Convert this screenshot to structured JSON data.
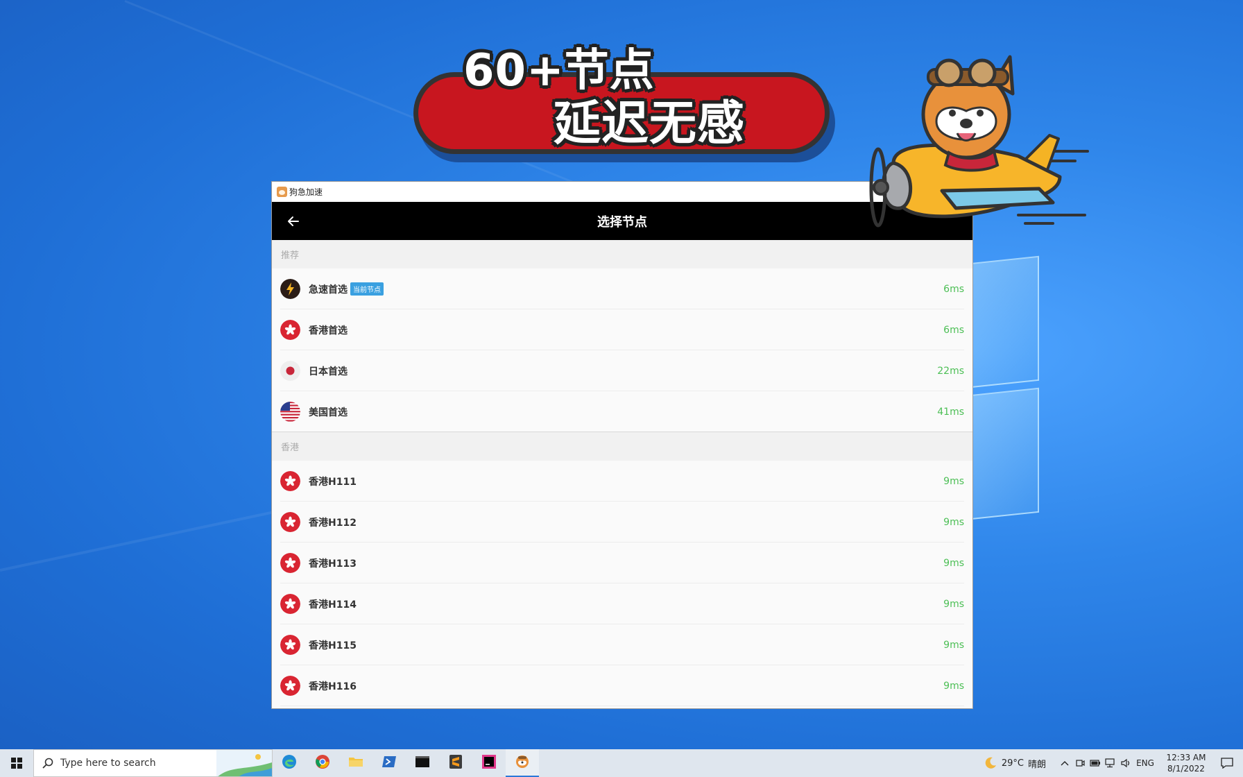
{
  "banner": {
    "line1": "60+节点",
    "line2": "延迟无感"
  },
  "window": {
    "title": "狗急加速"
  },
  "header": {
    "title": "选择节点"
  },
  "sections": [
    {
      "label": "推荐",
      "rows": [
        {
          "name": "急速首选",
          "badge": "当前节点",
          "latency": "6ms",
          "flag": "bolt"
        },
        {
          "name": "香港首选",
          "latency": "6ms",
          "flag": "hk"
        },
        {
          "name": "日本首选",
          "latency": "22ms",
          "flag": "jp"
        },
        {
          "name": "美国首选",
          "latency": "41ms",
          "flag": "us"
        }
      ]
    },
    {
      "label": "香港",
      "rows": [
        {
          "name": "香港H111",
          "latency": "9ms",
          "flag": "hk"
        },
        {
          "name": "香港H112",
          "latency": "9ms",
          "flag": "hk"
        },
        {
          "name": "香港H113",
          "latency": "9ms",
          "flag": "hk"
        },
        {
          "name": "香港H114",
          "latency": "9ms",
          "flag": "hk"
        },
        {
          "name": "香港H115",
          "latency": "9ms",
          "flag": "hk"
        },
        {
          "name": "香港H116",
          "latency": "9ms",
          "flag": "hk"
        }
      ]
    }
  ],
  "taskbar": {
    "search_placeholder": "Type here to search",
    "apps": [
      "edge-icon",
      "chrome-icon",
      "file-explorer-icon",
      "powershell-icon",
      "terminal-icon",
      "sublime-icon",
      "intellij-icon",
      "dog-app-icon"
    ],
    "weather_temp": "29°C",
    "weather_desc": "晴朗",
    "language": "ENG",
    "time": "12:33 AM",
    "date": "8/1/2022"
  },
  "colors": {
    "accent_green": "#4cbf55",
    "badge_blue": "#3aa0e0",
    "banner_red": "#c8161f"
  }
}
